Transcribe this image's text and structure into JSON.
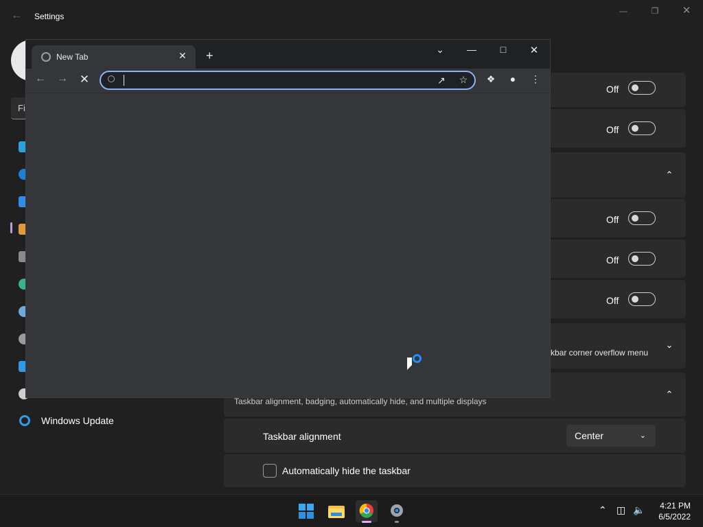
{
  "settings": {
    "title": "Settings",
    "find_placeholder": "Fi",
    "nav_windows_update": "Windows Update",
    "rows": [
      {
        "toggle_label": "Off"
      },
      {
        "toggle_label": "Off"
      },
      {
        "toggle_label": "Off"
      },
      {
        "toggle_label": "Off"
      },
      {
        "toggle_label": "Off"
      }
    ],
    "overflow_desc": "skbar corner overflow menu",
    "behaviors_desc": "Taskbar alignment, badging, automatically hide, and multiple displays",
    "alignment_label": "Taskbar alignment",
    "alignment_value": "Center",
    "autohide_label": "Automatically hide the taskbar"
  },
  "chrome": {
    "tab_title": "New Tab",
    "omnibox_value": ""
  },
  "taskbar": {
    "time": "4:21 PM",
    "date": "6/5/2022"
  },
  "colors": {
    "accent_blue": "#8ab4f8",
    "nav_accent": "#c59ad8",
    "spinner": "#1e90ff"
  }
}
